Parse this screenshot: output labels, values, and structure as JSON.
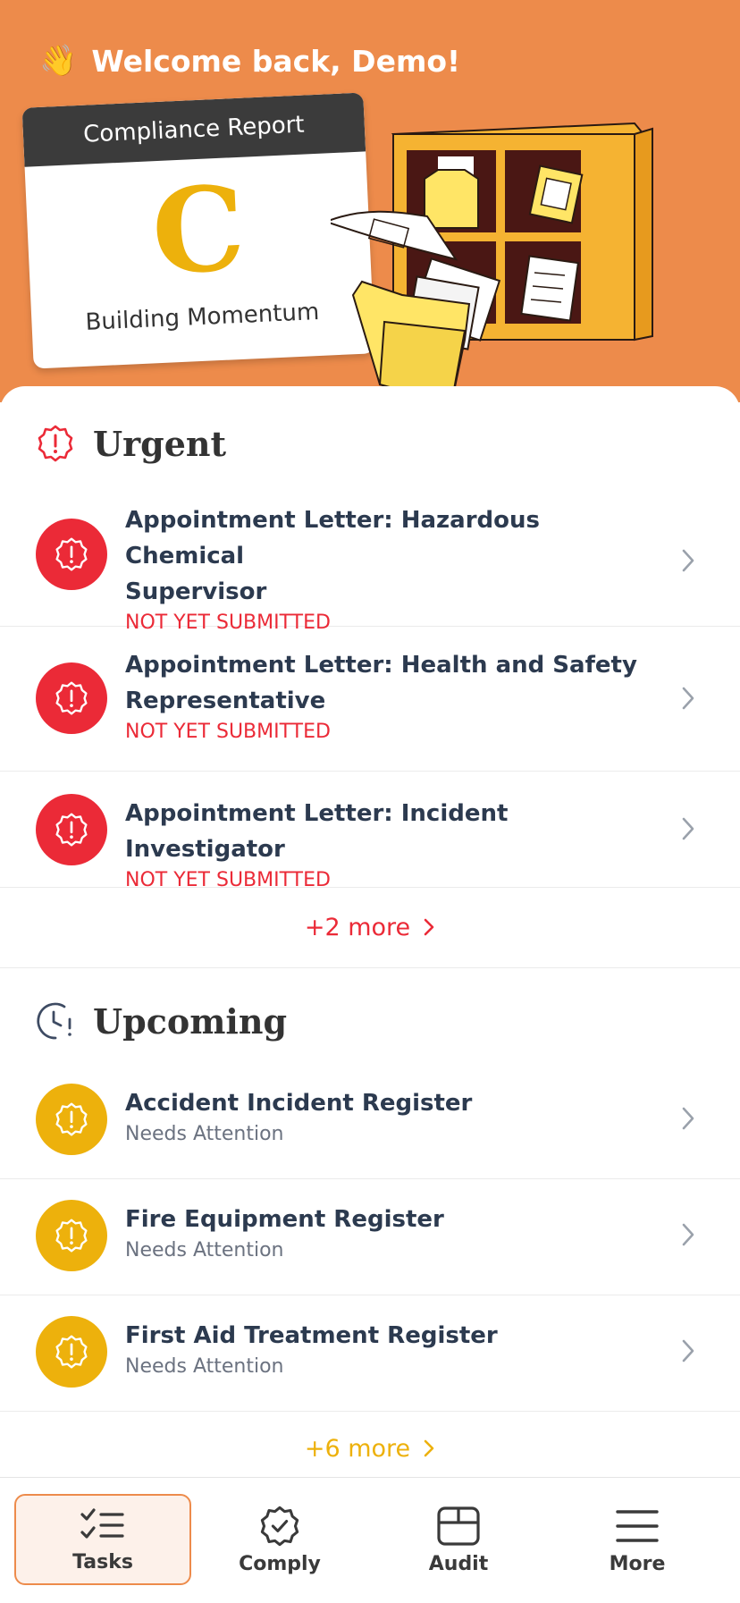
{
  "header": {
    "wave_emoji": "👋",
    "greeting": "Welcome back, Demo!",
    "report": {
      "title": "Compliance Report",
      "grade": "C",
      "status": "Building Momentum"
    },
    "illustration_icon": "filing-cabinet-folder-illustration",
    "colors": {
      "hero_bg": "#ED8B4B",
      "grade": "#EDB10C",
      "urgent": "#EB2A37",
      "upcoming": "#EDB10C"
    }
  },
  "urgent": {
    "title": "Urgent",
    "icon": "alert-badge-icon",
    "items": [
      {
        "title_line1": "Appointment Letter: Hazardous Chemical",
        "title_line2": "Supervisor",
        "status": "NOT YET SUBMITTED"
      },
      {
        "title_line1": "Appointment Letter: Health and Safety",
        "title_line2": "Representative",
        "status": "NOT YET SUBMITTED"
      },
      {
        "title_line1": "Appointment Letter: Incident Investigator",
        "status": "NOT YET SUBMITTED"
      }
    ],
    "more_label": "+2 more"
  },
  "upcoming": {
    "title": "Upcoming",
    "icon": "clock-alert-icon",
    "items": [
      {
        "title": "Accident Incident Register",
        "status": "Needs Attention"
      },
      {
        "title": "Fire Equipment Register",
        "status": "Needs Attention"
      },
      {
        "title": "First Aid Treatment Register",
        "status": "Needs Attention"
      }
    ],
    "more_label": "+6 more"
  },
  "tabbar": {
    "tabs": [
      {
        "label": "Tasks",
        "icon": "checklist-icon",
        "active": true
      },
      {
        "label": "Comply",
        "icon": "badge-check-icon",
        "active": false
      },
      {
        "label": "Audit",
        "icon": "box-icon",
        "active": false
      },
      {
        "label": "More",
        "icon": "menu-icon",
        "active": false
      }
    ]
  }
}
